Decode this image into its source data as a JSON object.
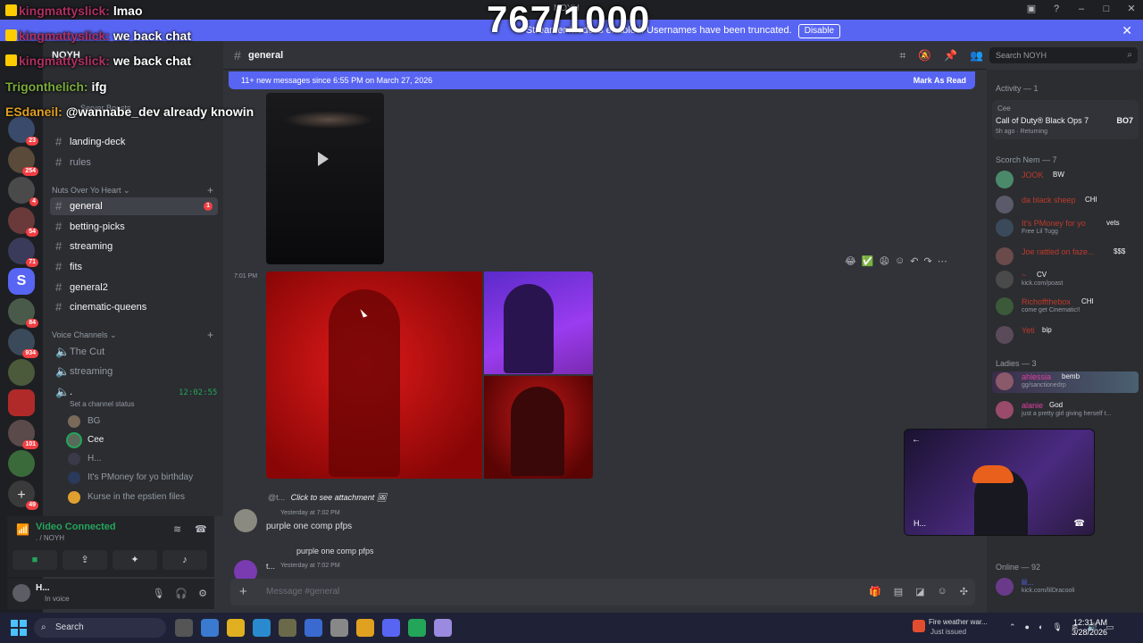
{
  "window": {
    "title": "NOYH"
  },
  "banner": {
    "text": "Streamer Mode is enabled. Usernames have been truncated.",
    "disable": "Disable"
  },
  "stream_overlay": {
    "counter": "767/1000",
    "chat": [
      {
        "user": "kingmattyslick:",
        "text": "lmao"
      },
      {
        "user": "kingmattyslick:",
        "text": "we back chat"
      },
      {
        "user": "kingmattyslick:",
        "text": "we back chat"
      },
      {
        "user": "Trigonthelich:",
        "text": "ifg"
      },
      {
        "user": "ESdaneil:",
        "text": "@wannabe_dev already knowin"
      }
    ]
  },
  "rail_badges": [
    "1",
    "23",
    "254",
    "4",
    "54",
    "71",
    "84",
    "934",
    "101",
    "49"
  ],
  "sidebar": {
    "server": "NOYH",
    "boosts": "Server Boosts",
    "channels_top": [
      "landing-deck",
      "rules"
    ],
    "category": "Nuts Over Yo Heart",
    "channels": [
      {
        "name": "general",
        "badge": "1"
      },
      {
        "name": "betting-picks"
      },
      {
        "name": "streaming"
      },
      {
        "name": "fits"
      },
      {
        "name": "general2"
      },
      {
        "name": "cinematic-queens"
      }
    ],
    "voice_category": "Voice Channels",
    "voice_channels": [
      "The Cut",
      "streaming",
      "."
    ],
    "voice_timer": "12:02:55",
    "channel_status": "Set a channel status",
    "voice_users": [
      "BG",
      "Cee",
      "H...",
      "It's PMoney for yo birthday",
      "Kurse in the epstien files"
    ]
  },
  "voice_panel": {
    "title": "Video Connected",
    "sub": ". / NOYH"
  },
  "user": {
    "name": "H...",
    "status": "In voice"
  },
  "channel": {
    "name": "general"
  },
  "search": {
    "placeholder": "Search NOYH"
  },
  "new_messages": {
    "text": "11+ new messages since 6:55 PM on March 27, 2026",
    "mark": "Mark As Read"
  },
  "messages": {
    "side_time": "7:01 PM",
    "reply": {
      "by": "@t...",
      "text": "Click to see attachment"
    },
    "m1": {
      "time": "Yesterday at 7:02 PM",
      "text": "purple one comp pfps"
    },
    "m2_reply": "purple one comp pfps",
    "m2": {
      "author": "t...",
      "time": "Yesterday at 7:02 PM"
    }
  },
  "composer": {
    "placeholder": "Message #general"
  },
  "members": {
    "activity_head": "Activity — 1",
    "activity": {
      "user": "Cee",
      "game": "Call of Duty® Black Ops 7",
      "time": "5h ago",
      "state": "Returning",
      "logo": "BO7"
    },
    "group1": "Scorch Nem — 7",
    "group1_members": [
      {
        "name": "JOOK",
        "tag": "BW",
        "sub": ""
      },
      {
        "name": "da black sheep",
        "tag": "CHI",
        "sub": ""
      },
      {
        "name": "It's PMoney for yo",
        "tag": "vets",
        "sub": "Free Lil Tugg"
      },
      {
        "name": "Joe rattled on faze...",
        "tag": "$$$",
        "sub": ""
      },
      {
        "name": "~",
        "tag": "CV",
        "sub": "kick.com/poast"
      },
      {
        "name": "Richoffthebox",
        "tag": "CHI",
        "sub": "come get Cinematic!!"
      },
      {
        "name": "Yeti",
        "tag": "bip",
        "sub": ""
      }
    ],
    "group2": "Ladies — 3",
    "group2_members": [
      {
        "name": "ahlessia",
        "tag": "bemb",
        "sub": "gg/sanctionedrp"
      },
      {
        "name": "alanie",
        "tag": "God",
        "sub": "just a pretty girl giving herself t..."
      }
    ],
    "online_head": "Online — 92",
    "online_members": [
      {
        "name": "lil...",
        "sub": "kick.com/lilDracooli"
      }
    ]
  },
  "pip": {
    "back": "←",
    "name": "H..."
  },
  "taskbar": {
    "search": "Search",
    "weather_title": "Fire weather war...",
    "weather_sub": "Just issued",
    "time": "12:31 AM",
    "date": "3/28/2026"
  }
}
